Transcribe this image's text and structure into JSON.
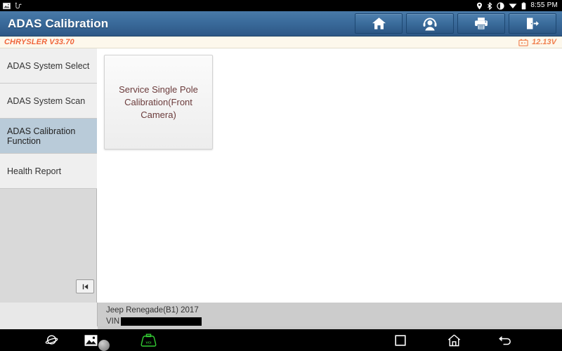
{
  "statusbar": {
    "left_icons": [
      "image-notification-icon",
      "usb-connection-icon"
    ],
    "right_icons": [
      "location-pin-icon",
      "bluetooth-icon",
      "sync-rotate-icon",
      "wifi-icon",
      "battery-icon"
    ],
    "time": "8:55 PM"
  },
  "header": {
    "title": "ADAS Calibration",
    "toolbar": [
      {
        "name": "home-button",
        "icon": "home-icon"
      },
      {
        "name": "support-button",
        "icon": "headset-person-icon"
      },
      {
        "name": "print-button",
        "icon": "printer-icon"
      },
      {
        "name": "exit-button",
        "icon": "exit-door-icon"
      }
    ]
  },
  "version_bar": {
    "vehicle_version": "CHRYSLER V33.70",
    "battery_icon": "car-battery-icon",
    "voltage": "12.13V",
    "accent_color": "#f0663c"
  },
  "sidebar": {
    "items": [
      {
        "label": "ADAS System Select",
        "selected": false
      },
      {
        "label": "ADAS System Scan",
        "selected": false
      },
      {
        "label": "ADAS Calibration Function",
        "selected": true
      },
      {
        "label": "Health Report",
        "selected": false
      }
    ],
    "collapse_button": {
      "name": "collapse-sidebar-button",
      "glyph": "❘◁"
    },
    "selected_color": "#b9cbd9"
  },
  "main": {
    "cards": [
      {
        "label": "Service Single Pole Calibration(Front Camera)"
      }
    ],
    "card_text_color": "#6b3b3b"
  },
  "vehicle_info": {
    "name": "Jeep Renegade(B1) 2017",
    "vin_label": "VIN",
    "vin_value": ""
  },
  "navbar": {
    "items": [
      {
        "name": "browser-button",
        "icon": "planet-browser-icon"
      },
      {
        "name": "gallery-button",
        "icon": "image-gallery-icon"
      },
      {
        "name": "vci-button",
        "icon": "vci-connector-icon",
        "color": "#33cc33"
      },
      {
        "name": "recent-apps-button",
        "icon": "square-icon"
      },
      {
        "name": "home-nav-button",
        "icon": "home-outline-icon"
      },
      {
        "name": "back-nav-button",
        "icon": "back-arrow-icon"
      }
    ]
  }
}
